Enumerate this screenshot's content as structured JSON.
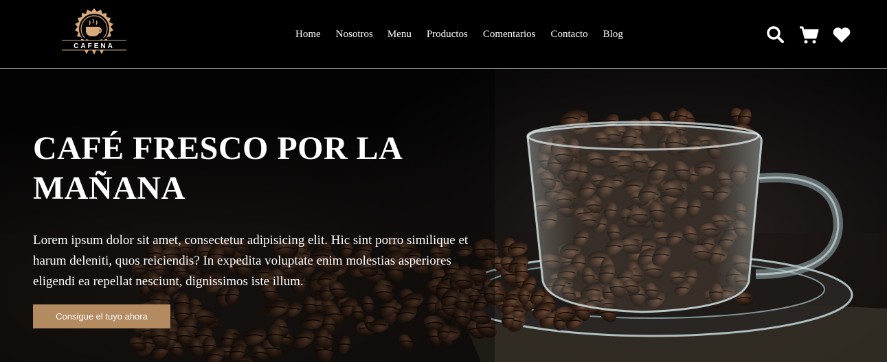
{
  "logo": {
    "text": "CAFENA",
    "icon": "coffee-cup-badge-icon",
    "color": "#d9aa7a"
  },
  "nav": {
    "items": [
      {
        "label": "Home"
      },
      {
        "label": "Nosotros"
      },
      {
        "label": "Menu"
      },
      {
        "label": "Productos"
      },
      {
        "label": "Comentarios"
      },
      {
        "label": "Contacto"
      },
      {
        "label": "Blog"
      }
    ]
  },
  "header_icons": [
    "search-icon",
    "cart-icon",
    "heart-icon"
  ],
  "hero": {
    "title": "CAFÉ FRESCO POR LA MAÑANA",
    "text": "Lorem ipsum dolor sit amet, consectetur adipisicing elit. Hic sint porro similique et harum deleniti, quos reiciendis? In expedita voluptate enim molestias asperiores eligendi ea repellat nesciunt, dignissimos iste illum.",
    "cta_label": "Consigue el tuyo ahora",
    "image": "coffee-beans-glass-cup"
  },
  "colors": {
    "accent": "#b48a60",
    "header_bg": "#000000",
    "text": "#ffffff"
  }
}
